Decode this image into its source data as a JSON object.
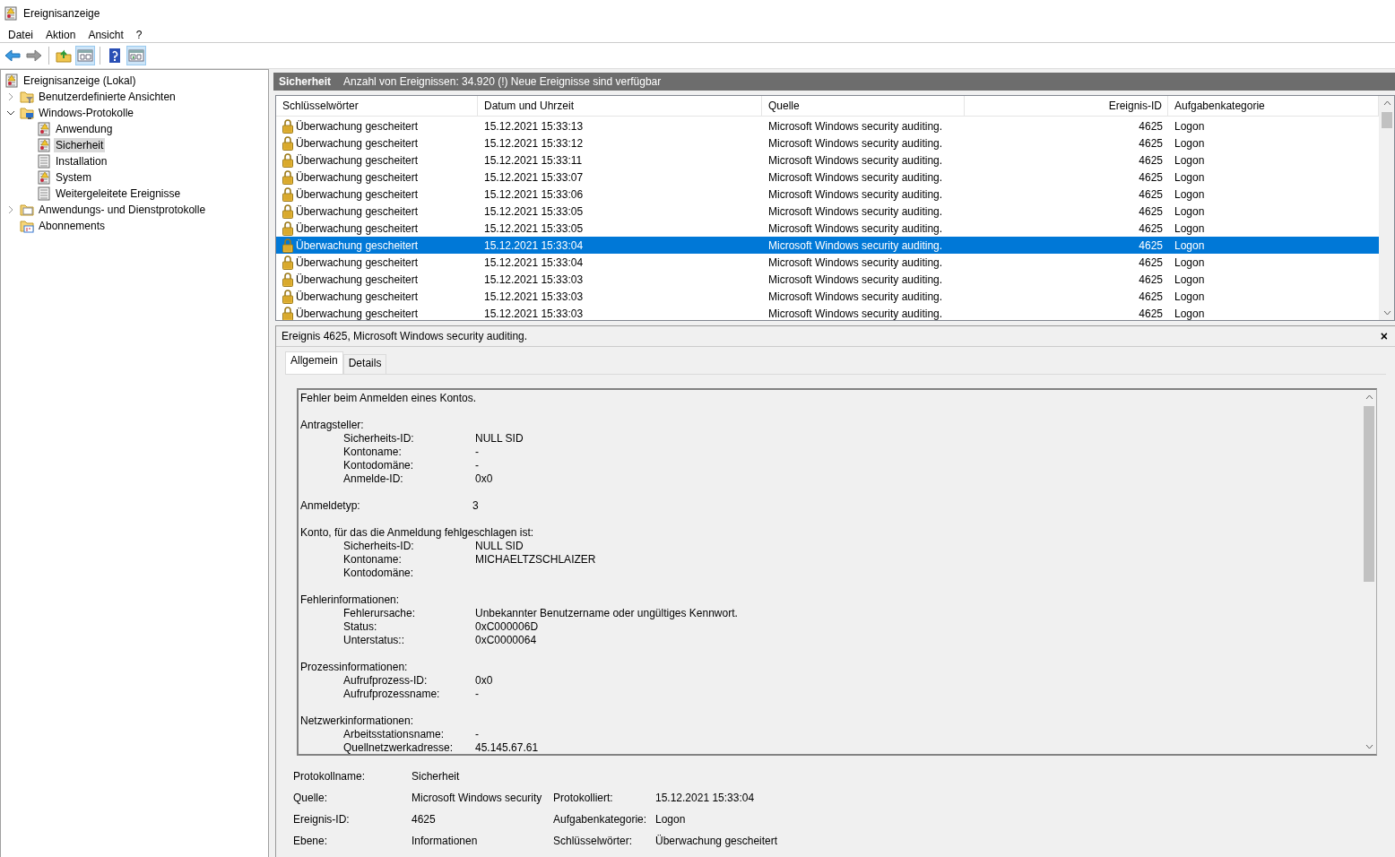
{
  "window": {
    "title": "Ereignisanzeige"
  },
  "menu": [
    "Datei",
    "Aktion",
    "Ansicht",
    "?"
  ],
  "toolbar": [
    {
      "kind": "back",
      "pressed": false
    },
    {
      "kind": "forward",
      "pressed": false
    },
    {
      "kind": "sep"
    },
    {
      "kind": "folder-up",
      "pressed": false
    },
    {
      "kind": "pane-left",
      "pressed": true
    },
    {
      "kind": "sep"
    },
    {
      "kind": "help",
      "pressed": false
    },
    {
      "kind": "pane-right",
      "pressed": true
    }
  ],
  "tree": [
    {
      "label": "Ereignisanzeige (Lokal)",
      "kind": "root",
      "selected": false,
      "children": [
        {
          "label": "Benutzerdefinierte Ansichten",
          "kind": "folder-filter",
          "expanded": false,
          "selected": false
        },
        {
          "label": "Windows-Protokolle",
          "kind": "folder-pc",
          "expanded": true,
          "selected": false,
          "children": [
            {
              "label": "Anwendung",
              "kind": "log-warning",
              "selected": false
            },
            {
              "label": "Sicherheit",
              "kind": "log-warning",
              "selected": true
            },
            {
              "label": "Installation",
              "kind": "log-plain",
              "selected": false
            },
            {
              "label": "System",
              "kind": "log-warning",
              "selected": false
            },
            {
              "label": "Weitergeleitete Ereignisse",
              "kind": "log-plain",
              "selected": false
            }
          ]
        },
        {
          "label": "Anwendungs- und Dienstprotokolle",
          "kind": "folder",
          "expanded": false,
          "selected": false
        },
        {
          "label": "Abonnements",
          "kind": "subscriptions",
          "selected": false
        }
      ]
    }
  ],
  "log_header": {
    "title": "Sicherheit",
    "info": "Anzahl von Ereignissen: 34.920 (!) Neue Ereignisse sind verfügbar"
  },
  "table": {
    "columns": [
      "Schlüsselwörter",
      "Datum und Uhrzeit",
      "Quelle",
      "Ereignis-ID",
      "Aufgabenkategorie"
    ],
    "rows": [
      {
        "keywords": "Überwachung gescheitert",
        "date": "15.12.2021 15:33:13",
        "source": "Microsoft Windows security auditing.",
        "event_id": "4625",
        "category": "Logon",
        "selected": false
      },
      {
        "keywords": "Überwachung gescheitert",
        "date": "15.12.2021 15:33:12",
        "source": "Microsoft Windows security auditing.",
        "event_id": "4625",
        "category": "Logon",
        "selected": false
      },
      {
        "keywords": "Überwachung gescheitert",
        "date": "15.12.2021 15:33:11",
        "source": "Microsoft Windows security auditing.",
        "event_id": "4625",
        "category": "Logon",
        "selected": false
      },
      {
        "keywords": "Überwachung gescheitert",
        "date": "15.12.2021 15:33:07",
        "source": "Microsoft Windows security auditing.",
        "event_id": "4625",
        "category": "Logon",
        "selected": false
      },
      {
        "keywords": "Überwachung gescheitert",
        "date": "15.12.2021 15:33:06",
        "source": "Microsoft Windows security auditing.",
        "event_id": "4625",
        "category": "Logon",
        "selected": false
      },
      {
        "keywords": "Überwachung gescheitert",
        "date": "15.12.2021 15:33:05",
        "source": "Microsoft Windows security auditing.",
        "event_id": "4625",
        "category": "Logon",
        "selected": false
      },
      {
        "keywords": "Überwachung gescheitert",
        "date": "15.12.2021 15:33:05",
        "source": "Microsoft Windows security auditing.",
        "event_id": "4625",
        "category": "Logon",
        "selected": false
      },
      {
        "keywords": "Überwachung gescheitert",
        "date": "15.12.2021 15:33:04",
        "source": "Microsoft Windows security auditing.",
        "event_id": "4625",
        "category": "Logon",
        "selected": true
      },
      {
        "keywords": "Überwachung gescheitert",
        "date": "15.12.2021 15:33:04",
        "source": "Microsoft Windows security auditing.",
        "event_id": "4625",
        "category": "Logon",
        "selected": false
      },
      {
        "keywords": "Überwachung gescheitert",
        "date": "15.12.2021 15:33:03",
        "source": "Microsoft Windows security auditing.",
        "event_id": "4625",
        "category": "Logon",
        "selected": false
      },
      {
        "keywords": "Überwachung gescheitert",
        "date": "15.12.2021 15:33:03",
        "source": "Microsoft Windows security auditing.",
        "event_id": "4625",
        "category": "Logon",
        "selected": false
      },
      {
        "keywords": "Überwachung gescheitert",
        "date": "15.12.2021 15:33:03",
        "source": "Microsoft Windows security auditing.",
        "event_id": "4625",
        "category": "Logon",
        "selected": false
      }
    ]
  },
  "detail": {
    "title": "Ereignis 4625, Microsoft Windows security auditing.",
    "close": "×",
    "tabs": [
      {
        "label": "Allgemein",
        "selected": true
      },
      {
        "label": "Details",
        "selected": false
      }
    ],
    "message": {
      "intro": "Fehler beim Anmelden eines Kontos.",
      "sections": [
        {
          "heading": "Antragsteller:",
          "fields": [
            {
              "label": "Sicherheits-ID:",
              "value": "NULL SID"
            },
            {
              "label": "Kontoname:",
              "value": "-"
            },
            {
              "label": "Kontodomäne:",
              "value": "-"
            },
            {
              "label": "Anmelde-ID:",
              "value": "0x0"
            }
          ]
        },
        {
          "heading": "Anmeldetyp:",
          "value": "3"
        },
        {
          "heading": "Konto, für das die Anmeldung fehlgeschlagen ist:",
          "fields": [
            {
              "label": "Sicherheits-ID:",
              "value": "NULL SID"
            },
            {
              "label": "Kontoname:",
              "value": "MICHAELTZSCHLAIZER"
            },
            {
              "label": "Kontodomäne:"
            }
          ]
        },
        {
          "heading": "Fehlerinformationen:",
          "fields": [
            {
              "label": "Fehlerursache:",
              "value": "Unbekannter Benutzername oder ungültiges Kennwort."
            },
            {
              "label": "Status:",
              "value": "0xC000006D"
            },
            {
              "label": "Unterstatus::",
              "value": "0xC0000064"
            }
          ]
        },
        {
          "heading": "Prozessinformationen:",
          "fields": [
            {
              "label": "Aufrufprozess-ID:",
              "value": "0x0"
            },
            {
              "label": "Aufrufprozessname:",
              "value": "-"
            }
          ]
        },
        {
          "heading": "Netzwerkinformationen:",
          "fields": [
            {
              "label": "Arbeitsstationsname:",
              "value": "-"
            },
            {
              "label": "Quellnetzwerkadresse:",
              "value": "45.145.67.61"
            }
          ]
        }
      ]
    },
    "properties": [
      [
        {
          "label": "Protokollname:",
          "value": "Sicherheit"
        }
      ],
      [
        {
          "label": "Quelle:",
          "value": "Microsoft Windows security"
        },
        {
          "label": "Protokolliert:",
          "value": "15.12.2021 15:33:04"
        }
      ],
      [
        {
          "label": "Ereignis-ID:",
          "value": "4625"
        },
        {
          "label": "Aufgabenkategorie:",
          "value": "Logon"
        }
      ],
      [
        {
          "label": "Ebene:",
          "value": "Informationen"
        },
        {
          "label": "Schlüsselwörter:",
          "value": "Überwachung gescheitert"
        }
      ]
    ]
  }
}
